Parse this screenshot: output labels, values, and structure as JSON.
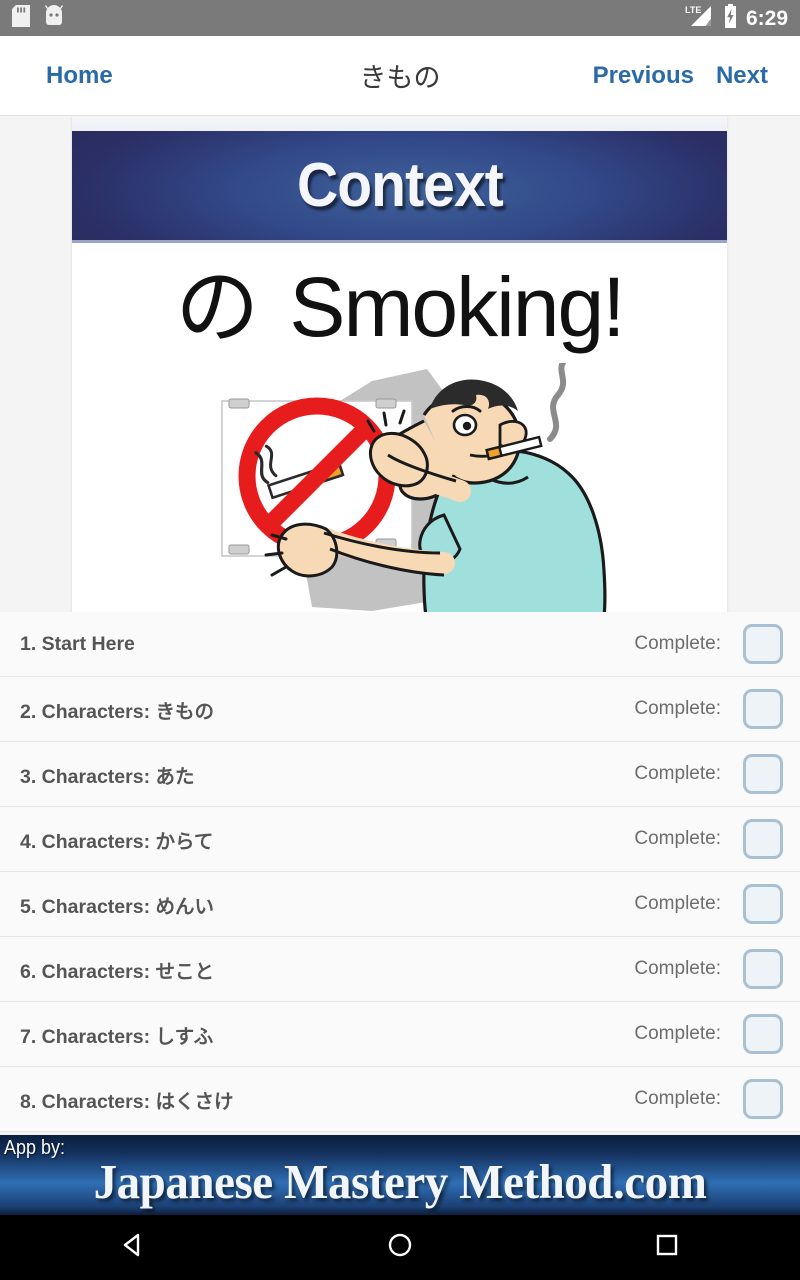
{
  "status_bar": {
    "icons": [
      "sd-card-icon",
      "android-robot-icon"
    ],
    "signal": "LTE",
    "battery": "battery-charging-icon",
    "time": "6:29",
    "background": "#7a7a7a"
  },
  "action_bar": {
    "home_label": "Home",
    "title": "きもの",
    "previous_label": "Previous",
    "next_label": "Next",
    "link_color": "#2b6aa8"
  },
  "lesson_image": {
    "banner_text": "Context",
    "headline_jp": "の",
    "headline_en": "Smoking!",
    "illustration": "man-posting-no-smoking-sign-cartoon",
    "banner_color_dark": "#272a57",
    "banner_color_light": "#3f6299"
  },
  "lesson_list": {
    "complete_label": "Complete:",
    "items": [
      {
        "title": "1. Start Here",
        "complete_label": "Complete:",
        "checked": false
      },
      {
        "title": "2. Characters: きもの",
        "complete_label": "Complete:",
        "checked": false
      },
      {
        "title": "3. Characters: あた",
        "complete_label": "Complete:",
        "checked": false
      },
      {
        "title": "4. Characters: からて",
        "complete_label": "Complete:",
        "checked": false
      },
      {
        "title": "5. Characters: めんい",
        "complete_label": "Complete:",
        "checked": false
      },
      {
        "title": "6. Characters: せこと",
        "complete_label": "Complete:",
        "checked": false
      },
      {
        "title": "7. Characters: しすふ",
        "complete_label": "Complete:",
        "checked": false
      },
      {
        "title": "8. Characters: はくさけ",
        "complete_label": "Complete:",
        "checked": false
      }
    ]
  },
  "footer_banner": {
    "app_by": "App by:",
    "brand": "Japanese Mastery Method.com"
  },
  "nav_bar": {
    "back": "back-triangle-icon",
    "home": "home-circle-icon",
    "recents": "recents-square-icon"
  }
}
